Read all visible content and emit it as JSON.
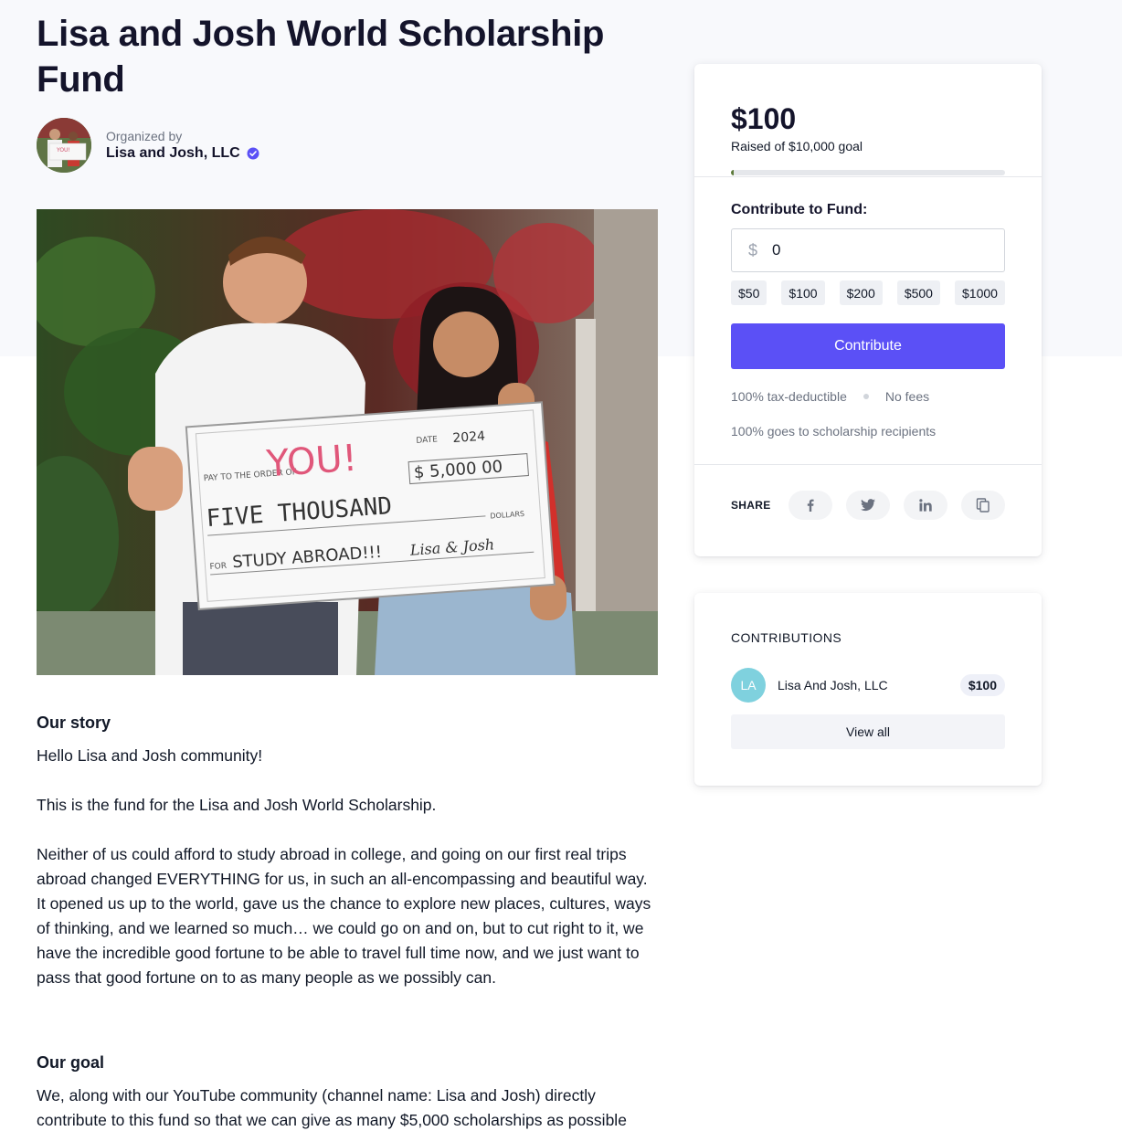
{
  "page": {
    "title": "Lisa and Josh World Scholarship Fund"
  },
  "organizer": {
    "label": "Organized by",
    "name": "Lisa and Josh, LLC"
  },
  "hero": {
    "check": {
      "pay_to": "PAY TO THE ORDER OF",
      "payee": "YOU!",
      "date_label": "DATE",
      "date": "2024",
      "amount": "$ 5,000 00",
      "words": "FIVE THOUSAND",
      "dollars": "DOLLARS",
      "for_label": "FOR",
      "memo": "STUDY ABROAD!!!",
      "signature": "Lisa & Josh"
    }
  },
  "story": {
    "heading": "Our story",
    "p1": "Hello Lisa and Josh community!",
    "p2": "This is the fund for the Lisa and Josh World Scholarship.",
    "p3": "Neither of us could afford to study abroad in college, and going on our first real trips abroad changed EVERYTHING for us, in such an all-encompassing and beautiful way. It opened us up to the world, gave us the chance to explore new places, cultures, ways of thinking, and we learned so much… we could go on and on, but to cut right to it, we have the incredible good fortune to be able to travel full time now, and we just want to pass that good fortune on to as many people as we possibly can.",
    "goal_heading": "Our goal",
    "p4": "We, along with our YouTube community (channel name: Lisa and Josh) directly contribute to this fund so that we can give as many $5,000 scholarships as possible"
  },
  "fund": {
    "raised_amount": "$100",
    "raised_text": "Raised of $10,000 goal",
    "progress": 0.01,
    "contribute_label": "Contribute to Fund:",
    "currency_symbol": "$",
    "input_value": "0",
    "presets": [
      "$50",
      "$100",
      "$200",
      "$500",
      "$1000"
    ],
    "contribute_button": "Contribute",
    "perk1": "100% tax-deductible",
    "perk2": "No fees",
    "perk3": "100% goes to scholarship recipients",
    "share_label": "SHARE",
    "share_icons": [
      "facebook-icon",
      "twitter-icon",
      "linkedin-icon",
      "copy-icon"
    ]
  },
  "contributions": {
    "title": "CONTRIBUTIONS",
    "items": [
      {
        "initials": "LA",
        "name": "Lisa And Josh, LLC",
        "amount": "$100"
      }
    ],
    "view_all": "View all"
  },
  "colors": {
    "accent": "#5b50f6",
    "progress": "#5c7a3a",
    "avatar": "#7fd1de",
    "verified": "#5b50f6"
  }
}
